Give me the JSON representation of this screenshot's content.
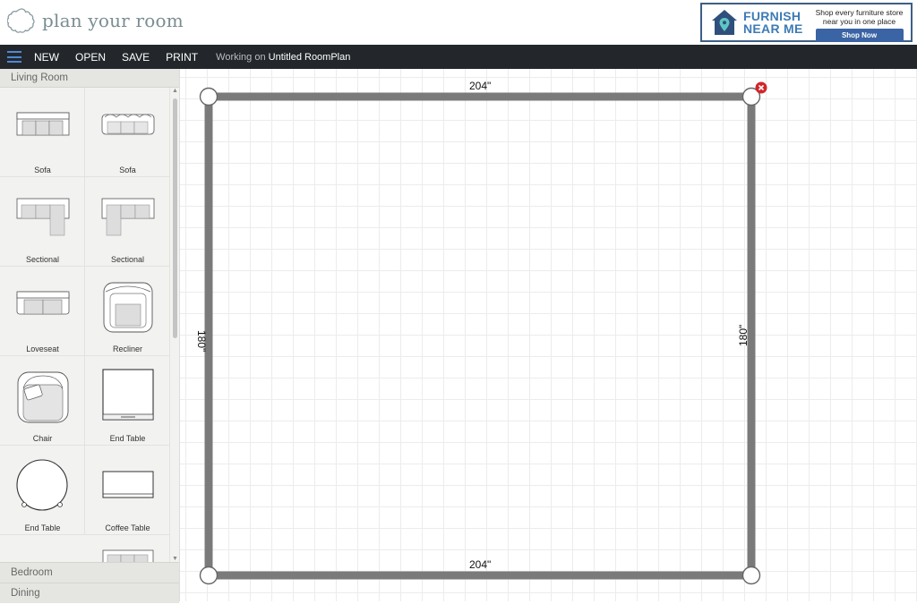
{
  "header": {
    "logo_text": "plan your room",
    "logo_icon": "cloud-outline-icon",
    "ad": {
      "brand_line1": "FURNISH",
      "brand_line2": "NEAR ME",
      "tagline_line1": "Shop every furniture store",
      "tagline_line2": "near you in one place",
      "button": "Shop Now",
      "accent": "#3d7bb5"
    }
  },
  "toolbar": {
    "menu_icon": "hamburger-icon",
    "new": "NEW",
    "open": "OPEN",
    "save": "SAVE",
    "print": "PRINT",
    "working_prefix": "Working on",
    "working_name": "Untitled RoomPlan"
  },
  "sidebar": {
    "category": "Living Room",
    "items": [
      {
        "label": "Sofa",
        "icon": "sofa-icon"
      },
      {
        "label": "Sofa",
        "icon": "sofa-cushioned-icon"
      },
      {
        "label": "Sectional",
        "icon": "sectional-left-icon"
      },
      {
        "label": "Sectional",
        "icon": "sectional-right-icon"
      },
      {
        "label": "Loveseat",
        "icon": "loveseat-icon"
      },
      {
        "label": "Recliner",
        "icon": "recliner-icon"
      },
      {
        "label": "Chair",
        "icon": "chair-icon"
      },
      {
        "label": "End Table",
        "icon": "square-end-table-icon"
      },
      {
        "label": "End Table",
        "icon": "round-end-table-icon"
      },
      {
        "label": "Coffee Table",
        "icon": "coffee-table-icon"
      }
    ],
    "other_categories": [
      "Bedroom",
      "Dining"
    ]
  },
  "room": {
    "top_width": "204\"",
    "bottom_width": "204\"",
    "left_height": "180\"",
    "right_height": "180\"",
    "delete_icon": "close-circle-icon",
    "wall_color": "#7a7a7a",
    "delete_color": "#d0262b"
  }
}
